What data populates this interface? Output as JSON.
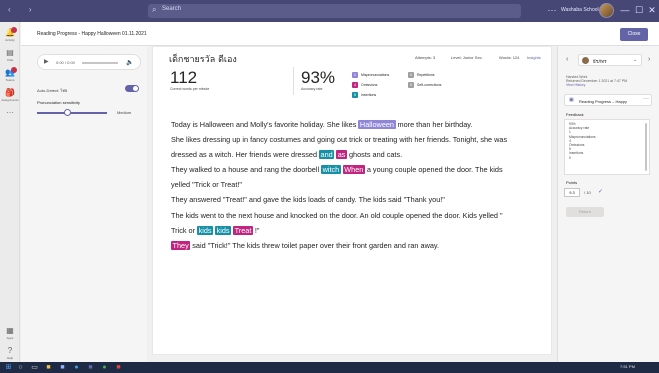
{
  "titlebar": {
    "nav_arrows": "‹ ›",
    "search_placeholder": "Search",
    "user_name": "Washaba School",
    "controls": [
      "···",
      "—",
      "☐",
      "✕"
    ]
  },
  "rail": [
    {
      "icon": "activity-icon",
      "glyph": "🔔",
      "label": "Activity",
      "badge": true
    },
    {
      "icon": "chat-icon",
      "glyph": "▤",
      "label": "Chat",
      "badge": false
    },
    {
      "icon": "teams-icon",
      "glyph": "👥",
      "label": "Teams",
      "badge": true
    },
    {
      "icon": "assignments-icon",
      "glyph": "🎒",
      "label": "Assignments",
      "badge": false
    },
    {
      "icon": "more-icon",
      "glyph": "···",
      "label": "",
      "badge": false
    },
    {
      "icon": "apps-icon",
      "glyph": "▦",
      "label": "Apps",
      "badge": false
    },
    {
      "icon": "help-icon",
      "glyph": "?",
      "label": "Help",
      "badge": false
    }
  ],
  "header": {
    "breadcrumb": "Reading Progress - Happy Halloween 01.11.2021",
    "close_label": "Close"
  },
  "options": {
    "time": "0:00 / 0:00",
    "auto_detect": "Auto-Detect: ไทย",
    "sensitivity_label": "Pronunciation sensitivity",
    "sensitivity_value": "Medium",
    "sensitivity_level": 0.43
  },
  "report": {
    "student_name": "เด็กชายรวัล ดีเอง",
    "attempts": "Attempts: 3",
    "level": "Level: Junior Sec.",
    "words": "Words: 124",
    "insights": "Insights",
    "wpm": "112",
    "wpm_label": "Correct words per minute",
    "accuracy": "93%",
    "accuracy_label": "Accuracy rate",
    "categories": [
      {
        "count": "1",
        "label": "Mispronunciations",
        "color": "#8f86d9"
      },
      {
        "count": "4",
        "label": "Omissions",
        "color": "#c2257f"
      },
      {
        "count": "5",
        "label": "Insertions",
        "color": "#1590a6"
      },
      {
        "count": "0",
        "label": "Repetitions",
        "color": "#a19f9d"
      },
      {
        "count": "0",
        "label": "Self-corrections",
        "color": "#a19f9d"
      }
    ]
  },
  "passage": {
    "line1_a": "Today is Halloween and Molly's favorite holiday. She likes ",
    "line1_hl": "Halloween",
    "line1_b": " more than her birthday.",
    "line2": "She likes dressing up in fancy costumes and going out trick or treating with her friends. Tonight, she was",
    "line3_a": "dressed as a witch. Her friends were dressed ",
    "line3_hl1": "and",
    "line3_hl2": "as",
    "line3_b": " ghosts and cats.",
    "line4_a": "They walked to a house and rang the doorbell ",
    "line4_hl1": "witch",
    "line4_hl2": "When",
    "line4_b": " a young couple opened the door. The kids",
    "line5": "yelled \"Trick or Treat!\"",
    "line6": "They answered \"Treat!\" and gave the kids loads of candy. The kids said \"Thank you!\"",
    "line7": "The kids went to the next house and knocked on the door. An old couple opened the door. Kids yelled \"",
    "line8_a": "Trick or ",
    "line8_hl1": "kids",
    "line8_hl2": "kids",
    "line8_hl3": "Treat",
    "line8_b": " !\"",
    "line9_hl": "They",
    "line9_b": " said \"Trick!\" The kids threw toilet paper over their front garden and ran away."
  },
  "side": {
    "student_name": "ธีรภัทร",
    "handed_in": "Handed Work",
    "handed_date": "Returned December 1 2021 at 7:47 PM",
    "view_history": "View History",
    "assignment": "Reading Progress – Happy",
    "feedback_label": "Feedback",
    "feedback_lines": [
      "93%",
      "Accuracy rate",
      "1",
      "Mispronunciations",
      "4",
      "Omissions",
      "5",
      "Insertions",
      "0"
    ],
    "points_label": "Points",
    "points_value": "9.3",
    "points_max": "/ 10",
    "return_label": "Return"
  },
  "taskbar": {
    "time": "7:51 PM"
  }
}
